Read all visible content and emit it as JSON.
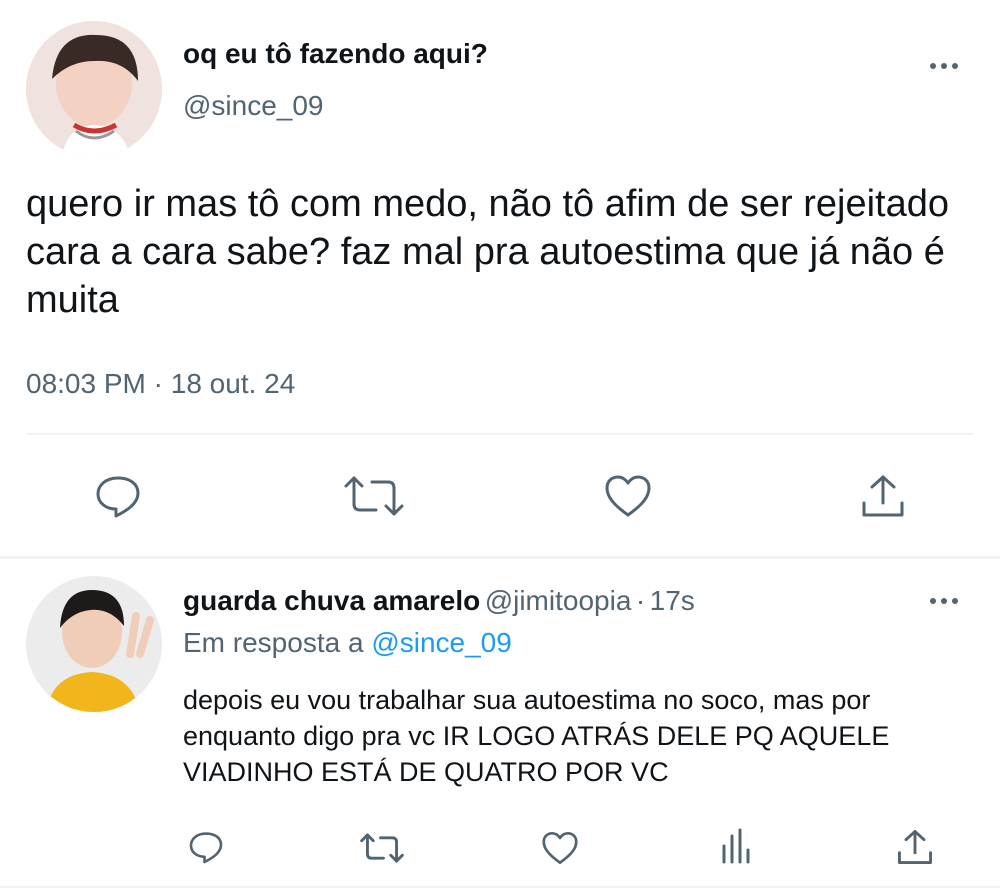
{
  "main_tweet": {
    "author_name": "oq eu tô fazendo aqui?",
    "handle": "@since_09",
    "text": "quero ir mas tô com medo, não tô afim de ser rejeitado cara a cara sabe? faz mal pra autoestima que já não é muita",
    "time": "08:03 PM",
    "separator": "·",
    "date": "18 out. 24",
    "more_icon": "more-horizontal-icon",
    "actions": [
      "reply-icon",
      "retweet-icon",
      "like-icon",
      "share-icon"
    ]
  },
  "reply_tweet": {
    "author_name": "guarda chuva amarelo",
    "handle": "@jimitoopia",
    "separator": "·",
    "time_ago": "17s",
    "in_reply_label": "Em resposta a",
    "in_reply_handle": "@since_09",
    "text": "depois eu vou trabalhar sua autoestima no soco, mas por enquanto digo pra vc IR LOGO ATRÁS DELE PQ AQUELE VIADINHO ESTÁ DE QUATRO POR VC",
    "more_icon": "more-horizontal-icon",
    "actions": [
      "reply-icon",
      "retweet-icon",
      "like-icon",
      "analytics-icon",
      "share-icon"
    ]
  },
  "colors": {
    "text_primary": "#0f1419",
    "text_secondary": "#536471",
    "link": "#1d9bf0",
    "divider": "#eff3f4",
    "background": "#ffffff"
  }
}
